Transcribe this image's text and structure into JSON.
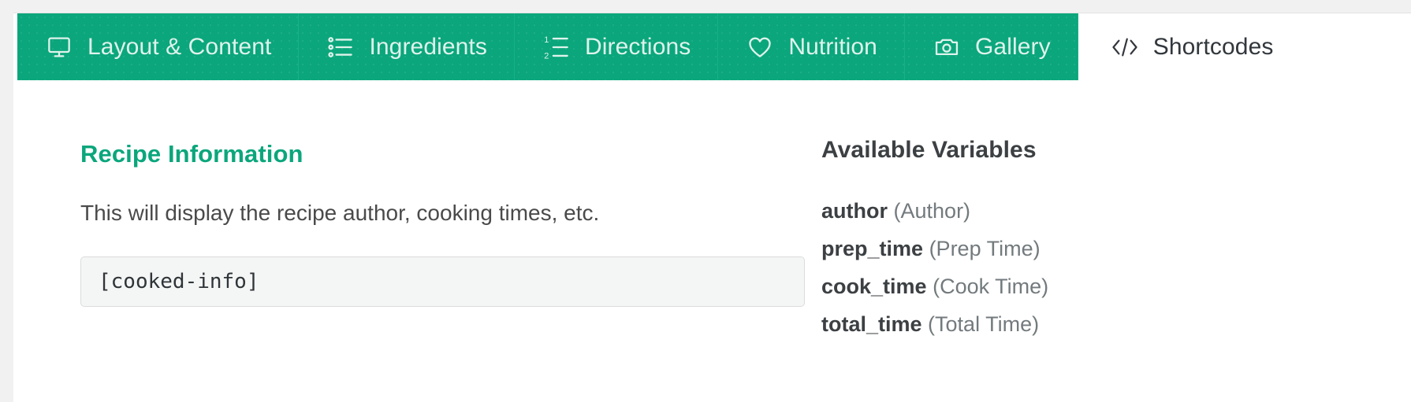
{
  "window": {
    "background_color": "#f1f1f1",
    "panel_color": "#ffffff",
    "accent_color": "#0ba67c"
  },
  "tabs": [
    {
      "id": "layout-content",
      "label": "Layout & Content",
      "icon": "monitor-icon",
      "active": false
    },
    {
      "id": "ingredients",
      "label": "Ingredients",
      "icon": "bullet-list-icon",
      "active": false
    },
    {
      "id": "directions",
      "label": "Directions",
      "icon": "numbered-list-icon",
      "active": false
    },
    {
      "id": "nutrition",
      "label": "Nutrition",
      "icon": "heart-icon",
      "active": false
    },
    {
      "id": "gallery",
      "label": "Gallery",
      "icon": "camera-icon",
      "active": false
    },
    {
      "id": "shortcodes",
      "label": "Shortcodes",
      "icon": "code-icon",
      "active": true
    }
  ],
  "main": {
    "section_title": "Recipe Information",
    "section_description": "This will display the recipe author, cooking times, etc.",
    "shortcode_value": "[cooked-info]",
    "shortcode_placeholder": "[cooked-info]"
  },
  "sidebar": {
    "title": "Available Variables",
    "variables": [
      {
        "key": "author",
        "description": "(Author)"
      },
      {
        "key": "prep_time",
        "description": "(Prep Time)"
      },
      {
        "key": "cook_time",
        "description": "(Cook Time)"
      },
      {
        "key": "total_time",
        "description": "(Total Time)"
      }
    ]
  }
}
